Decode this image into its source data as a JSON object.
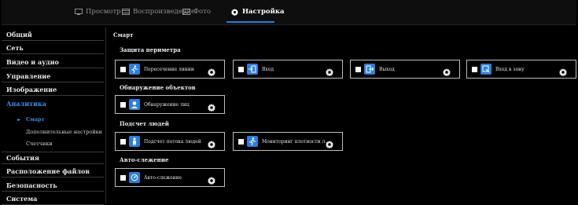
{
  "tabs": {
    "preview": "Просмотр",
    "playback": "Воспроизведение",
    "photo": "Фото",
    "settings": "Настройка"
  },
  "sidebar": {
    "items": [
      "Общий",
      "Сеть",
      "Видео и аудио",
      "Управление",
      "Изображение",
      "Аналитика",
      "События",
      "Расположение файлов",
      "Безопасность",
      "Система"
    ],
    "active_item": "Аналитика",
    "sub_items": [
      "Смарт",
      "Дополнительные настройки",
      "Счетчики"
    ],
    "active_sub_item": "Смарт"
  },
  "main": {
    "title": "Смарт",
    "sections": {
      "perimeter": {
        "title": "Защита периметра",
        "cards": [
          "Пересечение линии",
          "Вход",
          "Выход",
          "Вход в зону"
        ]
      },
      "object_detection": {
        "title": "Обнаружение объектов",
        "cards": [
          "Обнаружение лиц"
        ]
      },
      "people_counting": {
        "title": "Подсчет людей",
        "cards": [
          "Подсчет потока людей",
          "Мониторинг плотности л..."
        ]
      },
      "auto_tracking": {
        "title": "Авто-слежение",
        "cards": [
          "Авто-слежение"
        ]
      }
    }
  },
  "colors": {
    "accent": "#1f7fe0",
    "icon_bg": "#2d7fd6",
    "background": "#000000"
  },
  "icons": {
    "line_crossing": "running-man-icon",
    "enter": "enter-door-icon",
    "exit": "exit-door-icon",
    "zone_enter": "zone-icon",
    "face": "face-icon",
    "people_flow": "person-icon",
    "density": "running-man-icon",
    "auto_tracking": "target-icon",
    "settings": "gear-icon"
  }
}
